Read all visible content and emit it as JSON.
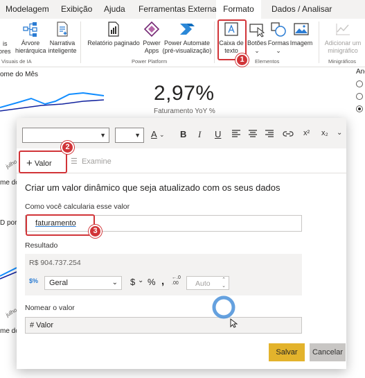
{
  "ribbon": {
    "tabs": [
      "Modelagem",
      "Exibição",
      "Ajuda",
      "Ferramentas Externas",
      "Formato",
      "Dados / Analisar"
    ],
    "active_tab": "Formato",
    "buttons": {
      "cut_left": "is",
      "cut_left_2": "ores",
      "arvore": "Árvore",
      "arvore_2": "hierárquica",
      "narrativa": "Narrativa",
      "narrativa_2": "inteligente",
      "relatorio": "Relatório paginado",
      "power_apps": "Power",
      "power_apps_2": "Apps",
      "power_automate": "Power Automate",
      "power_automate_2": "(pré-visualização)",
      "caixa_texto": "Caixa de",
      "caixa_texto_2": "texto",
      "botoes": "Botões",
      "formas": "Formas",
      "imagem": "Imagem",
      "minigrafico": "Adicionar um",
      "minigrafico_2": "minigráfico"
    },
    "groups": {
      "ia": "Visuais de IA",
      "power_platform": "Power Platform",
      "elementos": "Elementos",
      "minigraficos": "Minigráficos"
    }
  },
  "canvas": {
    "chart_title": "ome do Mês",
    "kpi_value": "2,97%",
    "kpi_label": "Faturamento YoY %",
    "side_label": "Ano",
    "axis_1": "julho",
    "axis_2": "julho",
    "frag_1": "me do",
    "frag_2": "D por",
    "frag_3": "me do"
  },
  "dialog": {
    "tab_valor": "Valor",
    "tab_examine": "Examine",
    "title": "Criar um valor dinâmico que seja atualizado com os seus dados",
    "calc_label": "Como você calcularia esse valor",
    "calc_value": "faturamento",
    "result_label": "Resultado",
    "result_value": "R$ 904.737.254",
    "format_selected": "Geral",
    "decimals_placeholder": "Auto",
    "name_label": "Nomear o valor",
    "name_value": "# Valor",
    "save_button": "Salvar",
    "cancel_button": "Cancelar"
  },
  "callouts": [
    "1",
    "2",
    "3"
  ],
  "colors": {
    "accent_red": "#d13438",
    "save_yellow": "#e3b32c",
    "cursor_blue": "#4a90d9"
  }
}
